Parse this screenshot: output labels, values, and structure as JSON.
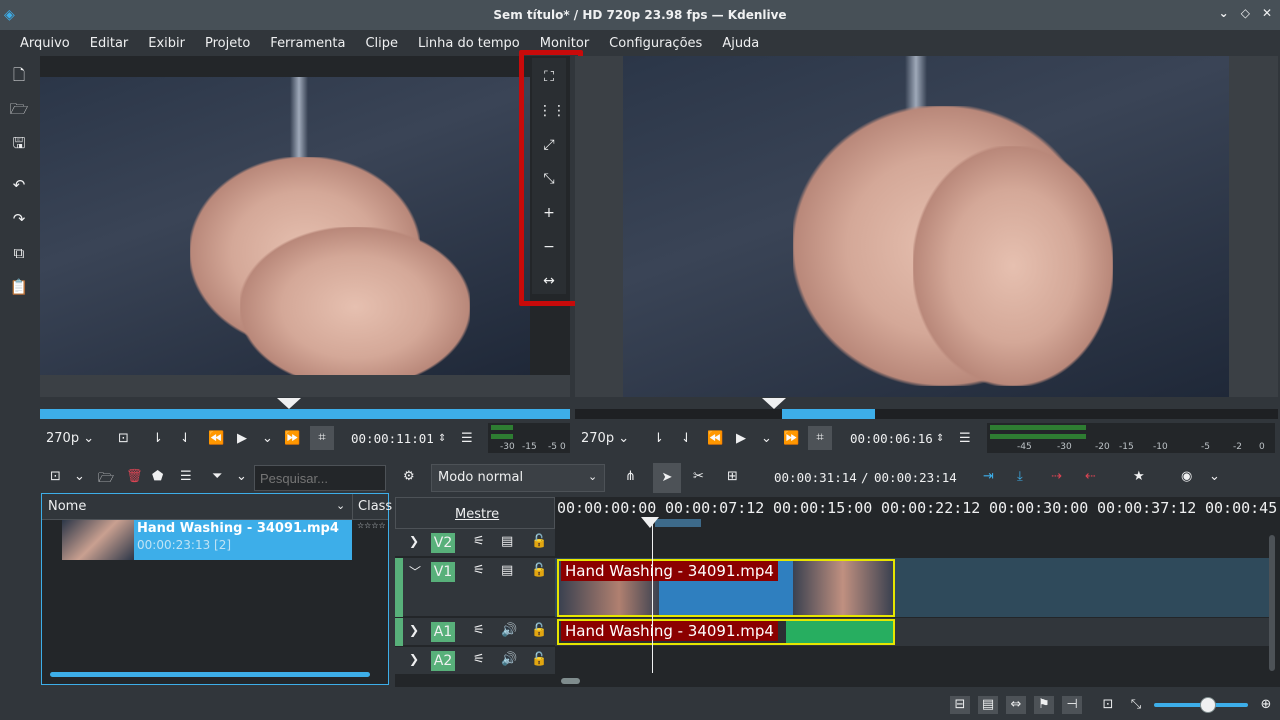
{
  "window": {
    "title": "Sem título* / HD 720p 23.98 fps — Kdenlive"
  },
  "menu": [
    "Arquivo",
    "Editar",
    "Exibir",
    "Projeto",
    "Ferramenta",
    "Clipe",
    "Linha do tempo",
    "Monitor",
    "Configurações",
    "Ajuda"
  ],
  "clip_monitor": {
    "zoom": "270p",
    "timecode": "00:00:11:01",
    "vu_labels": [
      "-30",
      "-15",
      "-5",
      "0"
    ],
    "playhead_fraction": 0.47
  },
  "project_monitor": {
    "zoom": "270p",
    "timecode": "00:00:06:16",
    "vu_labels": [
      "-45",
      "-30",
      "-20",
      "-15",
      "-10",
      "-5",
      "-2",
      "0"
    ],
    "playhead_fraction": 0.28
  },
  "monitor_toolbar": {
    "tools": [
      "fit-zoom-icon",
      "grid-icon",
      "zoom-in-region-icon",
      "zoom-out-region-icon",
      "zoom-plus-icon",
      "zoom-minus-icon",
      "more-icon"
    ]
  },
  "bin": {
    "search_placeholder": "Pesquisar...",
    "columns": {
      "name": "Nome",
      "class": "Class"
    },
    "items": [
      {
        "name": "Hand Washing - 34091.mp4",
        "duration": "00:00:23:13 [2]",
        "rating": "☆☆☆☆"
      }
    ]
  },
  "timeline": {
    "edit_mode": "Modo normal",
    "position": "00:00:31:14",
    "duration": "00:00:23:14",
    "master_label": "Mestre",
    "ruler": [
      "00:00:00:00",
      "00:00:07:12",
      "00:00:15:00",
      "00:00:22:12",
      "00:00:30:00",
      "00:00:37:12",
      "00:00:45:"
    ],
    "tracks": [
      {
        "id": "V2",
        "type": "video"
      },
      {
        "id": "V1",
        "type": "video"
      },
      {
        "id": "A1",
        "type": "audio"
      },
      {
        "id": "A2",
        "type": "audio"
      }
    ],
    "clips": {
      "video": "Hand Washing - 34091.mp4",
      "audio": "Hand Washing - 34091.mp4"
    }
  },
  "colors": {
    "accent": "#3daee9",
    "track": "#58b07a",
    "clip_label": "#8b0000",
    "highlight": "#c80a0a"
  }
}
